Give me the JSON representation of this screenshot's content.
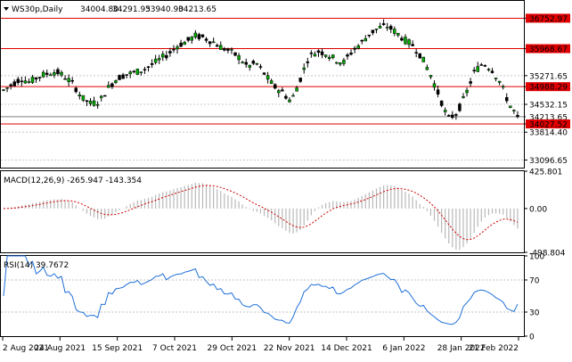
{
  "header": {
    "symbol": "WS30p,Daily",
    "open": "34004.80",
    "high": "34291.95",
    "low": "33940.90",
    "close": "34213.65"
  },
  "price_panel": {
    "ylim": [
      32900,
      37200
    ],
    "y_ticks": [
      "36752.97",
      "35968.67",
      "35271.65",
      "34988.29",
      "34532.15",
      "34213.65",
      "34027.52",
      "33814.40",
      "33096.65"
    ],
    "horizontal_lines": [
      36752.97,
      35968.67,
      34988.29,
      34027.52
    ],
    "line_color": "#e00000",
    "current_price": 34213.65,
    "up_color": "#00aa00",
    "down_color": "#000000"
  },
  "macd_panel": {
    "label": "MACD(12,26,9) -265.947 -143.354",
    "y_ticks": [
      "425.801",
      "0.00",
      "-498.804"
    ],
    "ylim": [
      -498.804,
      425.801
    ]
  },
  "rsi_panel": {
    "label": "RSI(14) 39.7672",
    "y_ticks": [
      "100",
      "70",
      "30",
      "0"
    ],
    "ylim": [
      0,
      100
    ]
  },
  "x_axis": {
    "ticks": [
      "2 Aug 2021",
      "24 Aug 2021",
      "15 Sep 2021",
      "7 Oct 2021",
      "29 Oct 2021",
      "22 Nov 2021",
      "14 Dec 2021",
      "6 Jan 2022",
      "28 Jan 2022",
      "21 Feb 2022"
    ]
  },
  "chart_data": [
    {
      "type": "candlestick",
      "title": "WS30p,Daily",
      "y_range": [
        33096.65,
        36752.97
      ],
      "close_path_samples": [
        34900,
        35050,
        35200,
        35100,
        35250,
        35320,
        35380,
        35250,
        35050,
        34700,
        34550,
        34600,
        34950,
        35200,
        35300,
        35350,
        35420,
        35550,
        35700,
        35850,
        36050,
        36150,
        36300,
        36250,
        36150,
        36000,
        35900,
        35750,
        35500,
        35600,
        35300,
        35000,
        34850,
        34600,
        35150,
        35750,
        35900,
        35850,
        35700,
        35600,
        35900,
        36100,
        36350,
        36500,
        36550,
        36400,
        36200,
        36050,
        35750,
        35300,
        34750,
        34150,
        34300,
        34750,
        35350,
        35600,
        35450,
        35100,
        34550,
        34213.65
      ],
      "current_value": 34213.65
    },
    {
      "type": "line",
      "title": "MACD(12,26,9)",
      "series": [
        {
          "name": "MACD",
          "value": -265.947
        },
        {
          "name": "Signal",
          "value": -143.354
        }
      ],
      "ylim": [
        -498.804,
        425.801
      ]
    },
    {
      "type": "line",
      "title": "RSI(14)",
      "series": [
        {
          "name": "RSI",
          "value": 39.7672
        }
      ],
      "ylim": [
        0,
        100
      ],
      "levels": [
        70,
        30
      ]
    }
  ]
}
